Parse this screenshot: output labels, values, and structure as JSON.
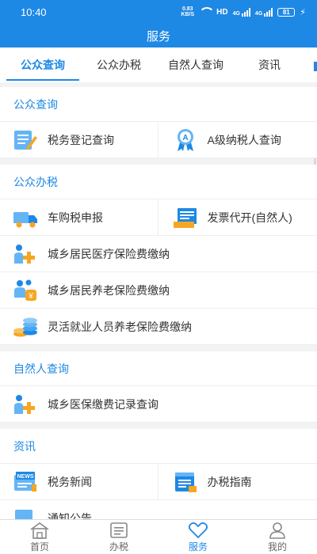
{
  "status": {
    "time": "10:40",
    "net_speed_value": "0.83",
    "net_speed_unit": "KB/S",
    "hd": "HD",
    "signal1": "4G",
    "signal2": "4G",
    "battery": "81"
  },
  "header": {
    "title": "服务"
  },
  "tabs": [
    {
      "label": "公众查询",
      "active": true
    },
    {
      "label": "公众办税"
    },
    {
      "label": "自然人查询"
    },
    {
      "label": "资讯"
    }
  ],
  "sections": {
    "public_query": {
      "title": "公众查询",
      "items": [
        "税务登记查询",
        "A级纳税人查询"
      ]
    },
    "public_tax": {
      "title": "公众办税",
      "items": [
        "车购税申报",
        "发票代开(自然人)",
        "城乡居民医疗保险费缴纳",
        "城乡居民养老保险费缴纳",
        "灵活就业人员养老保险费缴纳"
      ]
    },
    "person_query": {
      "title": "自然人查询",
      "items": [
        "城乡医保缴费记录查询"
      ]
    },
    "news": {
      "title": "资讯",
      "items": [
        "税务新闻",
        "办税指南",
        "通知公告"
      ]
    }
  },
  "icons": {
    "a_badge_text": "A",
    "news_text": "NEWS"
  },
  "bottom_nav": [
    {
      "label": "首页",
      "icon": "home-icon"
    },
    {
      "label": "办税",
      "icon": "list-icon"
    },
    {
      "label": "服务",
      "icon": "heart-icon",
      "active": true
    },
    {
      "label": "我的",
      "icon": "user-icon"
    }
  ],
  "colors": {
    "accent": "#1e88e5",
    "icon_orange": "#f5a623",
    "icon_light_blue": "#64b5f6"
  }
}
